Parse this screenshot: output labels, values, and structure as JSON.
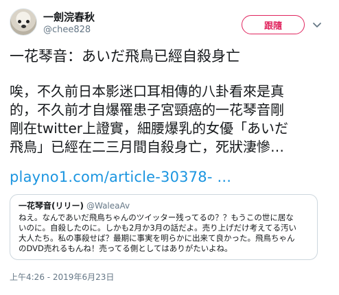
{
  "tweet": {
    "author_name": "一劍浣春秋",
    "author_handle": "@chee828",
    "follow_label": "跟隨",
    "title": "一花琴音：あいだ飛鳥已經自殺身亡",
    "body_lines": [
      "唉，不久前日本影迷口耳相傳的八卦看來是真",
      "的，不久前才自爆罹患子宮頸癌的一花琴音剛",
      "剛在twitter上證實，細腰爆乳的女優「あいだ",
      "飛鳥」已經在二三月間自殺身亡，死狀淒慘…"
    ],
    "link_text": "playno1.com/article-30378- ...",
    "timestamp": "上午4:26 - 2019年6月23日"
  },
  "quoted": {
    "name": "一花琴音(リリー)",
    "handle": "@WaleaAv",
    "lines": [
      "ねえ。なんであいだ飛鳥ちゃんのツイッター残ってるの？？もうこの世に居な",
      "いのに。自殺したのに。しかも2月か3月の話だよ。売り上げだけ考えてる汚い",
      "大人たち。私の事殺せば？最期に事実を明らかに出来て良かった。飛鳥ちゃん",
      "のDVD売れるもんね！売ってる側としてはありがたいよね。"
    ]
  },
  "icons": {
    "more": "chevron-down-icon",
    "avatar": "dog-avatar"
  },
  "colors": {
    "accent": "#e0245e",
    "link": "#1b95e0",
    "muted": "#657786"
  }
}
